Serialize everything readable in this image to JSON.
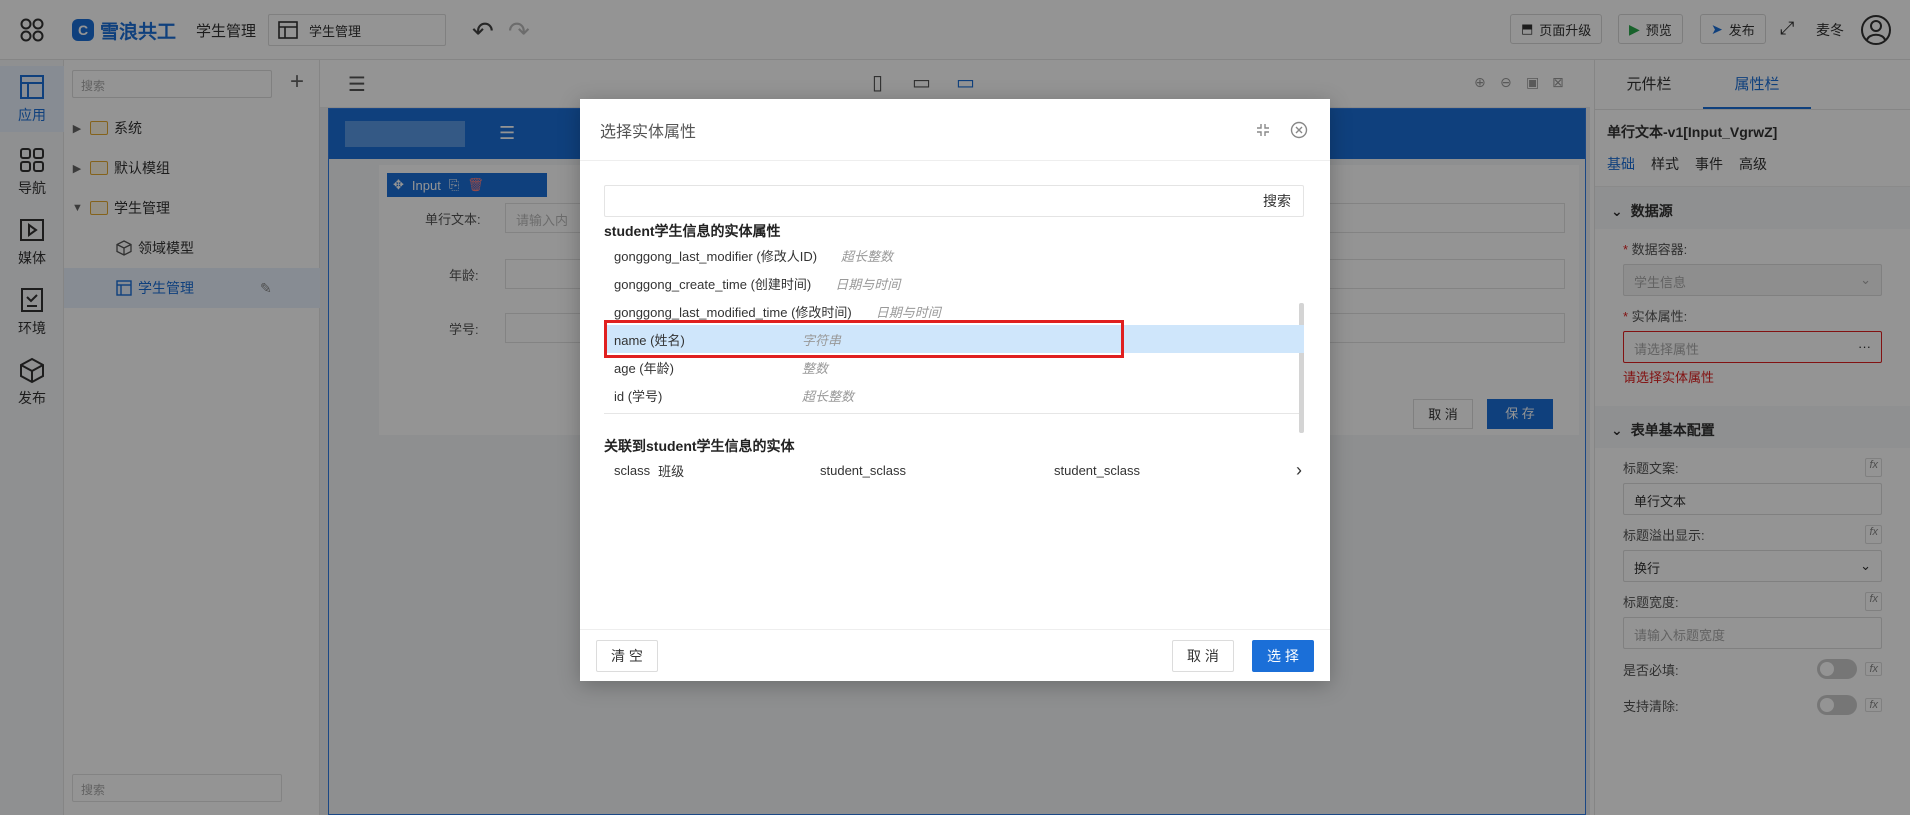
{
  "topbar": {
    "logo": "雪浪共工",
    "app_name": "学生管理",
    "page_name": "学生管理",
    "upgrade_label": "页面升级",
    "preview_label": "预览",
    "publish_label": "发布",
    "user_name": "麦冬"
  },
  "rail": {
    "items": [
      {
        "label": "应用",
        "icon": "app-layout-icon"
      },
      {
        "label": "导航",
        "icon": "grid-icon"
      },
      {
        "label": "媒体",
        "icon": "media-icon"
      },
      {
        "label": "环境",
        "icon": "env-icon"
      },
      {
        "label": "发布",
        "icon": "cube-icon"
      }
    ]
  },
  "tree": {
    "search_placeholder": "搜索",
    "nodes": [
      {
        "label": "系统"
      },
      {
        "label": "默认模组"
      },
      {
        "label": "学生管理"
      },
      {
        "label": "领域模型"
      },
      {
        "label": "学生管理"
      }
    ],
    "bottom_search_placeholder": "搜索"
  },
  "canvas": {
    "component_tag": "Input",
    "form_fields": [
      {
        "label": "单行文本:",
        "placeholder": "请输入内"
      },
      {
        "label": "年龄:"
      },
      {
        "label": "学号:"
      }
    ],
    "cancel_label": "取 消",
    "save_label": "保 存"
  },
  "props": {
    "tabs": [
      "元件栏",
      "属性栏"
    ],
    "component_title": "单行文本-v1[Input_VgrwZ]",
    "subtabs": [
      "基础",
      "样式",
      "事件",
      "高级"
    ],
    "section_datasource": "数据源",
    "label_container": "数据容器:",
    "value_container": "学生信息",
    "label_entity_attr": "实体属性:",
    "placeholder_entity_attr": "请选择属性",
    "error_entity_attr": "请选择实体属性",
    "section_form": "表单基本配置",
    "label_title_text": "标题文案:",
    "value_title_text": "单行文本",
    "label_overflow": "标题溢出显示:",
    "value_overflow": "换行",
    "label_title_width": "标题宽度:",
    "placeholder_title_width": "请输入标题宽度",
    "label_required": "是否必填:",
    "label_clearable": "支持清除:"
  },
  "modal": {
    "title": "选择实体属性",
    "search_label": "搜索",
    "group_title": "student学生信息的实体属性",
    "attributes": [
      {
        "name": "gonggong_last_modifier (修改人ID)",
        "type": "超长整数"
      },
      {
        "name": "gonggong_create_time (创建时间)",
        "type": "日期与时间"
      },
      {
        "name": "gonggong_last_modified_time (修改时间)",
        "type": "日期与时间"
      },
      {
        "name": "name (姓名)",
        "type": "字符串",
        "selected": true
      },
      {
        "name": "age (年龄)",
        "type": "整数"
      },
      {
        "name": "id (学号)",
        "type": "超长整数"
      }
    ],
    "relation_title": "关联到student学生信息的实体",
    "relations": [
      {
        "code": "sclass",
        "name": "班级",
        "field": "student_sclass",
        "ref": "student_sclass"
      }
    ],
    "clear_label": "清 空",
    "cancel_label": "取 消",
    "select_label": "选 择"
  }
}
